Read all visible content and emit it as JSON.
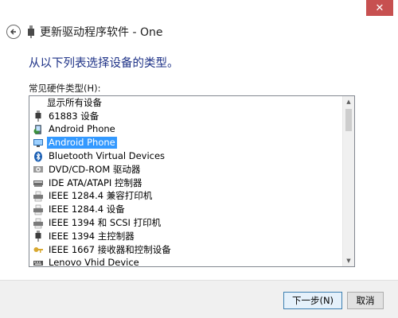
{
  "window": {
    "title": "更新驱动程序软件 - One",
    "close_glyph": "✕"
  },
  "heading": "从以下列表选择设备的类型。",
  "list": {
    "label": "常见硬件类型(H):",
    "items": [
      {
        "label": "显示所有设备",
        "icon": "none"
      },
      {
        "label": "61883 设备",
        "icon": "device-plug-icon"
      },
      {
        "label": "Android Phone",
        "icon": "phone-globe-icon"
      },
      {
        "label": "Android Phone",
        "icon": "monitor-phone-icon",
        "selected": true
      },
      {
        "label": "Bluetooth Virtual Devices",
        "icon": "bluetooth-icon"
      },
      {
        "label": "DVD/CD-ROM 驱动器",
        "icon": "dvd-drive-icon"
      },
      {
        "label": "IDE ATA/ATAPI 控制器",
        "icon": "ide-controller-icon"
      },
      {
        "label": "IEEE 1284.4 兼容打印机",
        "icon": "printer-icon"
      },
      {
        "label": "IEEE 1284.4 设备",
        "icon": "printer-icon"
      },
      {
        "label": "IEEE 1394 和 SCSI 打印机",
        "icon": "printer-icon"
      },
      {
        "label": "IEEE 1394 主控制器",
        "icon": "device-plug-icon"
      },
      {
        "label": "IEEE 1667 接收器和控制设备",
        "icon": "key-lock-icon"
      },
      {
        "label": "Lenovo Vhid Device",
        "icon": "keyboard-icon"
      }
    ]
  },
  "buttons": {
    "next": "下一步(N)",
    "cancel": "取消"
  },
  "colors": {
    "heading": "#1e3287",
    "selection": "#3399ff",
    "close_button": "#c75050"
  }
}
